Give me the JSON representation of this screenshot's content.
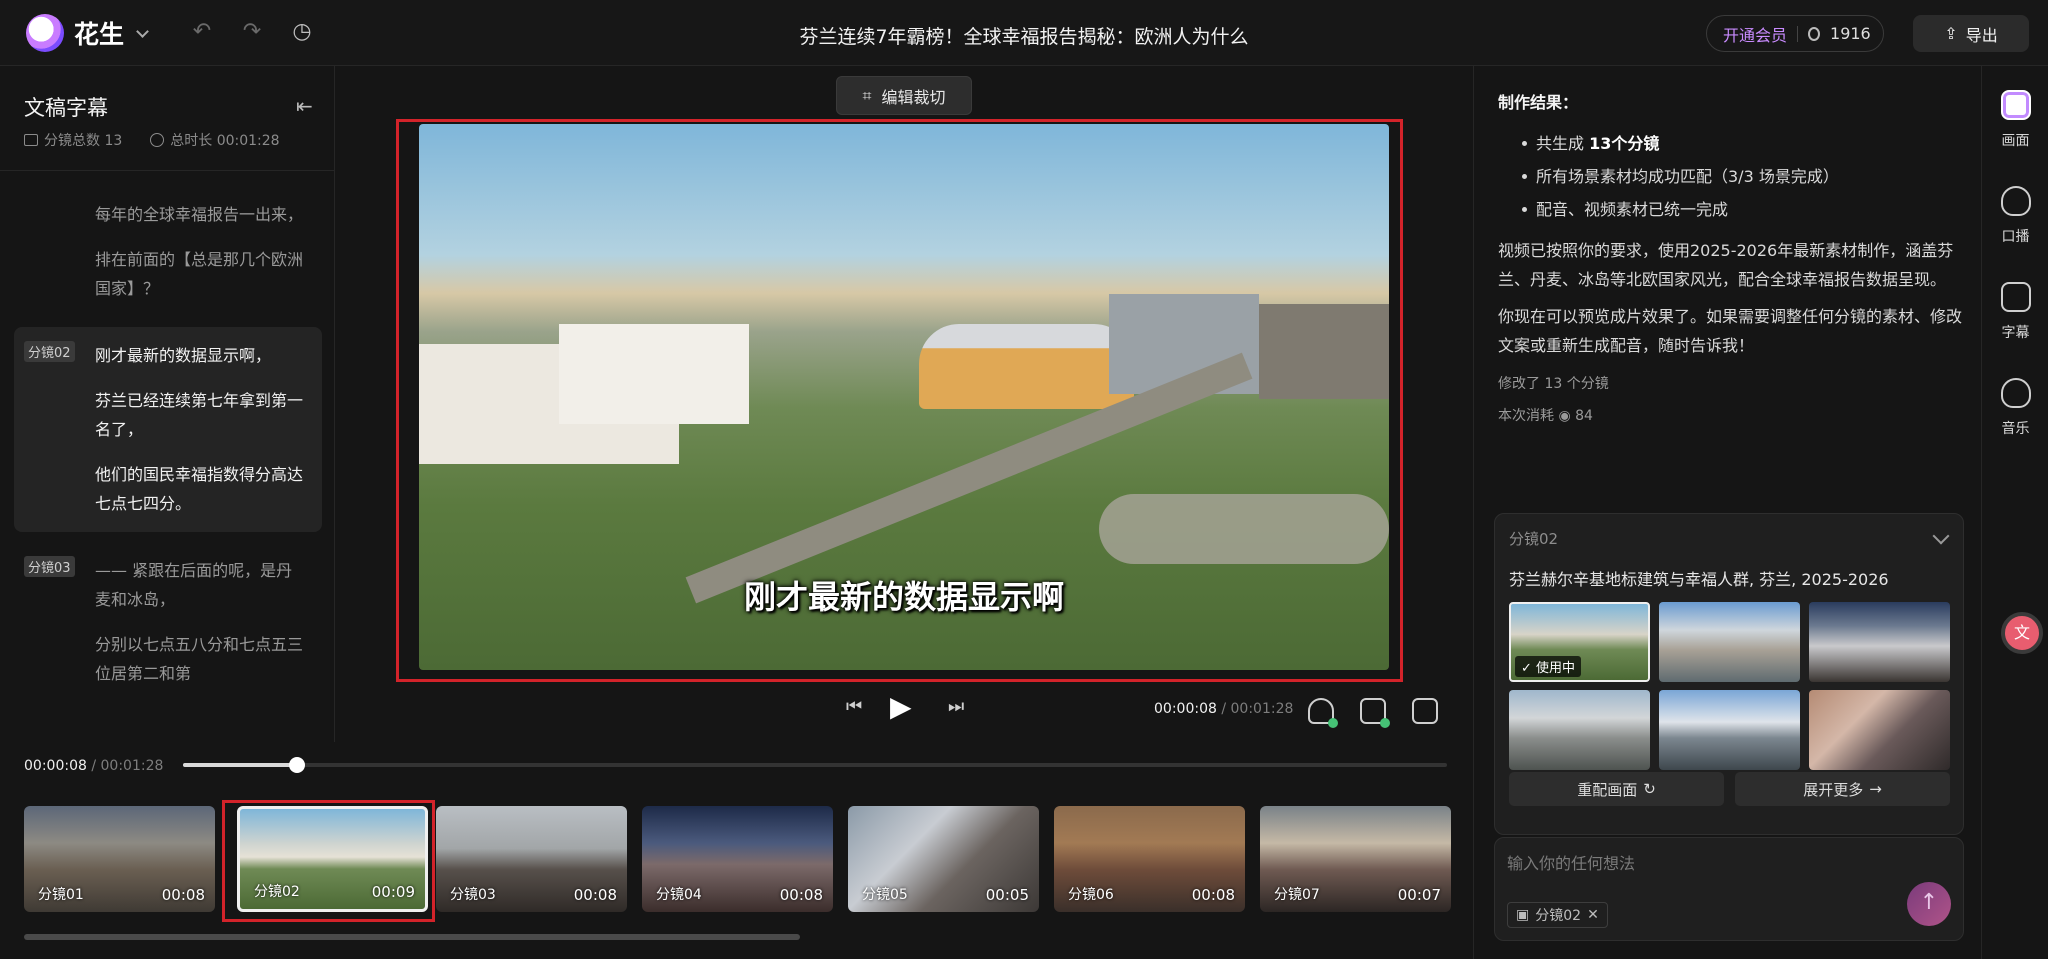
{
  "app": {
    "name": "花生"
  },
  "document": {
    "title": "芬兰连续7年霸榜！全球幸福报告揭秘：欧洲人为什么"
  },
  "header": {
    "vip_label": "开通会员",
    "points": "1916",
    "export_label": "导出"
  },
  "left_panel": {
    "title": "文稿字幕",
    "segment_count_label": "分镜总数 13",
    "total_duration_label": "总时长 00:01:28",
    "groups": [
      {
        "tag": "",
        "active": false,
        "lines": [
          "每年的全球幸福报告一出来，",
          "排在前面的【总是那几个欧洲国家】？"
        ]
      },
      {
        "tag": "分镜02",
        "active": true,
        "lines": [
          "刚才最新的数据显示啊，",
          "芬兰已经连续第七年拿到第一名了，",
          "他们的国民幸福指数得分高达七点七四分。"
        ]
      },
      {
        "tag": "分镜03",
        "active": false,
        "lines": [
          "—— 紧跟在后面的呢，是丹麦和冰岛，",
          "分别以七点五八分和七点五三位居第二和第"
        ]
      }
    ]
  },
  "preview": {
    "crop_label": "编辑裁切",
    "subtitle": "刚才最新的数据显示啊",
    "current_time": "00:00:08",
    "total_time": "00:01:28"
  },
  "timeline": {
    "current_time": "00:00:08",
    "total_time": "00:01:28",
    "progress": 0.09,
    "clips": [
      {
        "label": "分镜01",
        "duration": "00:08",
        "bg": "linear-gradient(to bottom,#5c6778 0%,#8d8a83 35%,#6a5f52 60%,#3f3a34 100%)",
        "selected": false
      },
      {
        "label": "分镜02",
        "duration": "00:09",
        "bg": "linear-gradient(to bottom,#7fb6d9 0%,#cfd4d0 35%,#e6e1d6 48%,#6f8a55 60%,#4c6a35 100%)",
        "selected": true
      },
      {
        "label": "分镜03",
        "duration": "00:08",
        "bg": "linear-gradient(to bottom,#b9bec3 0%,#a2a6a8 40%,#57504b 60%,#2f2a27 100%)",
        "selected": false
      },
      {
        "label": "分镜04",
        "duration": "00:08",
        "bg": "linear-gradient(to bottom,#1d2a48 0%,#4b5a7d 35%,#7c6a6a 55%,#3b2d2b 100%)",
        "selected": false
      },
      {
        "label": "分镜05",
        "duration": "00:05",
        "bg": "linear-gradient(135deg,#8b9aa8 0%,#c8ccd2 35%,#6b6460 60%,#3c3836 100%)",
        "selected": false
      },
      {
        "label": "分镜06",
        "duration": "00:08",
        "bg": "linear-gradient(to bottom,#8b6a4c 0%,#a27a54 35%,#6e4c3a 60%,#3a2f2a 100%)",
        "selected": false
      },
      {
        "label": "分镜07",
        "duration": "00:07",
        "bg": "linear-gradient(to bottom,#7a8288 0%,#c5b9a6 35%,#6f5a52 60%,#2c2624 100%)",
        "selected": false
      }
    ]
  },
  "right_panel": {
    "result_heading": "制作结果：",
    "bullets": [
      {
        "pre": "共生成 ",
        "bold": "13个分镜",
        "post": ""
      },
      {
        "pre": "所有场景素材均成功匹配（3/3 场景完成）",
        "bold": "",
        "post": ""
      },
      {
        "pre": "配音、视频素材已统一完成",
        "bold": "",
        "post": ""
      }
    ],
    "paragraph1": "视频已按照你的要求，使用2025-2026年最新素材制作，涵盖芬兰、丹麦、冰岛等北欧国家风光，配合全球幸福报告数据呈现。",
    "paragraph2": "你现在可以预览成片效果了。如果需要调整任何分镜的素材、修改文案或重新生成配音，随时告诉我！",
    "modified_note": "修改了 13 个分镜",
    "cost_label": "本次消耗",
    "cost_value": "84",
    "card": {
      "tag": "分镜02",
      "description": "芬兰赫尔辛基地标建筑与幸福人群, 芬兰, 2025-2026",
      "in_use_label": "使用中",
      "images": [
        {
          "bg": "linear-gradient(to bottom,#7fb6d9 0%,#d8d4c8 40%,#6f8a55 60%,#4c6a35 100%)",
          "in_use": true
        },
        {
          "bg": "linear-gradient(to bottom,#6a9bd0 0%,#cfd6dc 35%,#a8a196 60%,#5f6b70 100%)",
          "in_use": false
        },
        {
          "bg": "linear-gradient(to bottom,#2a3c5e 0%,#6c7a90 30%,#c9c9cc 55%,#3a3532 100%)",
          "in_use": false
        },
        {
          "bg": "linear-gradient(to bottom,#9fb7cc 0%,#d3d6d8 35%,#8b8e8c 60%,#4e5350 100%)",
          "in_use": false
        },
        {
          "bg": "linear-gradient(to bottom,#7aa6d6 0%,#dfe4ea 40%,#7c8790 60%,#3e474d 100%)",
          "in_use": false
        },
        {
          "bg": "linear-gradient(135deg,#b58b74 0%,#d4b7a8 35%,#6a5a5a 60%,#2f2a2a 100%)",
          "in_use": false
        }
      ],
      "rematch_label": "重配画面",
      "expand_label": "展开更多"
    },
    "input_placeholder": "输入你的任何想法",
    "chip_label": "分镜02"
  },
  "rail": {
    "items": [
      {
        "label": "画面",
        "active": true
      },
      {
        "label": "口播",
        "active": false
      },
      {
        "label": "字幕",
        "active": false
      },
      {
        "label": "音乐",
        "active": false
      }
    ]
  }
}
